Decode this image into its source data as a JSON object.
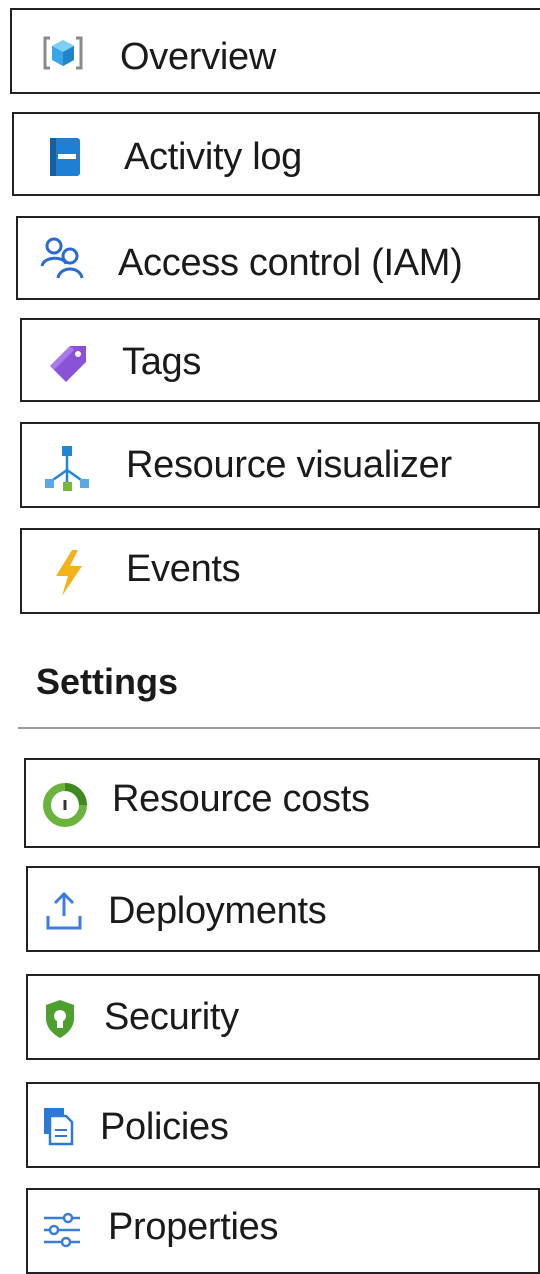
{
  "nav": {
    "items": [
      {
        "id": "overview",
        "label": "Overview",
        "icon": "cube-icon"
      },
      {
        "id": "activity-log",
        "label": "Activity log",
        "icon": "log-book-icon"
      },
      {
        "id": "access-control",
        "label": "Access control (IAM)",
        "icon": "users-icon"
      },
      {
        "id": "tags",
        "label": "Tags",
        "icon": "tag-icon"
      },
      {
        "id": "resource-visualizer",
        "label": "Resource visualizer",
        "icon": "hierarchy-icon"
      },
      {
        "id": "events",
        "label": "Events",
        "icon": "lightning-icon"
      }
    ]
  },
  "settings": {
    "title": "Settings",
    "items": [
      {
        "id": "resource-costs",
        "label": "Resource costs",
        "icon": "cost-icon"
      },
      {
        "id": "deployments",
        "label": "Deployments",
        "icon": "upload-icon"
      },
      {
        "id": "security",
        "label": "Security",
        "icon": "shield-icon"
      },
      {
        "id": "policies",
        "label": "Policies",
        "icon": "document-icon"
      },
      {
        "id": "properties",
        "label": "Properties",
        "icon": "sliders-icon"
      }
    ]
  },
  "colors": {
    "cube": "#3aa6e8",
    "activity_log": "#1e7fd4",
    "users": "#2b6bd1",
    "tag": "#8a52d6",
    "hierarchy": "#1f86d6",
    "lightning": "#f4b21a",
    "cost_ring": "#6cb33e",
    "upload": "#3b7dd8",
    "shield": "#4ea02e",
    "document": "#2d7ad6",
    "sliders": "#3b7dd8"
  }
}
